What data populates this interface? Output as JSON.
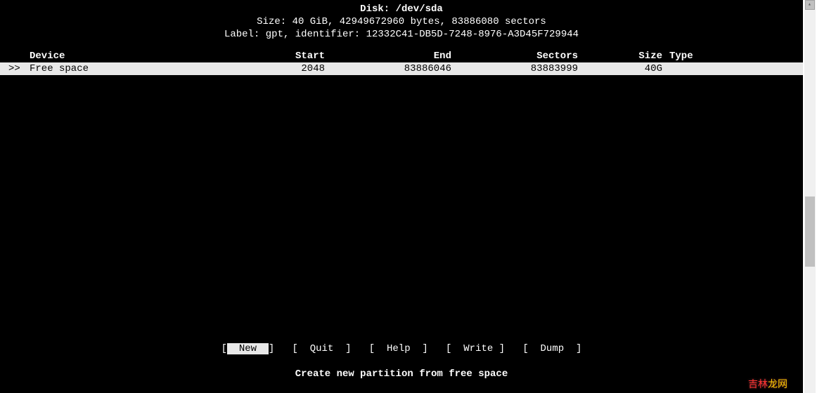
{
  "header": {
    "title_prefix": "Disk: ",
    "disk_path": "/dev/sda",
    "size_line": "Size: 40 GiB, 42949672960 bytes, 83886080 sectors",
    "label_line": "Label: gpt, identifier: 12332C41-DB5D-7248-8976-A3D45F729944"
  },
  "table": {
    "columns": {
      "device": "Device",
      "start": "Start",
      "end": "End",
      "sectors": "Sectors",
      "size": "Size",
      "type": "Type"
    },
    "rows": [
      {
        "marker": ">>",
        "device": "Free space",
        "start": "2048",
        "end": "83886046",
        "sectors": "83883999",
        "size": "40G",
        "type": "",
        "selected": true
      }
    ]
  },
  "menu": {
    "items": [
      {
        "label": "New",
        "selected": true
      },
      {
        "label": "Quit",
        "selected": false
      },
      {
        "label": "Help",
        "selected": false
      },
      {
        "label": "Write",
        "selected": false
      },
      {
        "label": "Dump",
        "selected": false
      }
    ]
  },
  "status": {
    "text": "Create new partition from free space"
  },
  "watermark": {
    "text": "吉林龙网"
  }
}
